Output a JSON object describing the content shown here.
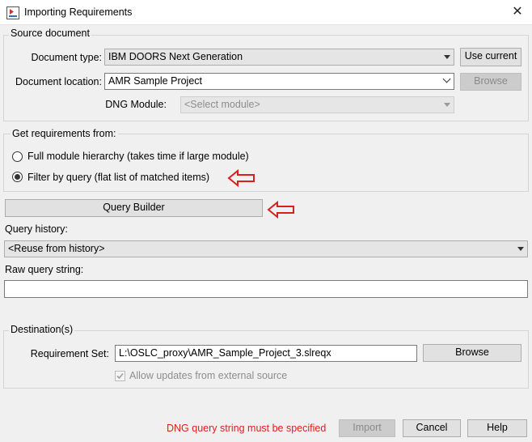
{
  "window": {
    "title": "Importing Requirements",
    "close_glyph": "✕"
  },
  "source": {
    "group_label": "Source document",
    "doc_type_label": "Document type:",
    "doc_type_value": "IBM DOORS Next Generation",
    "use_current_label": "Use current",
    "doc_location_label": "Document location:",
    "doc_location_value": "AMR Sample Project",
    "browse_label": "Browse",
    "module_label": "DNG Module:",
    "module_value": "<Select module>"
  },
  "get_reqs": {
    "group_label": "Get requirements from:",
    "option1": "Full module hierarchy (takes time if large module)",
    "option2": "Filter by query (flat list of matched items)",
    "selected": "option2"
  },
  "query": {
    "builder_label": "Query Builder",
    "history_label": "Query history:",
    "history_value": "<Reuse from history>",
    "raw_label": "Raw query string:",
    "raw_value": ""
  },
  "destination": {
    "group_label": "Destination(s)",
    "req_set_label": "Requirement Set:",
    "req_set_value": "L:\\OSLC_proxy\\AMR_Sample_Project_3.slreqx",
    "browse_label": "Browse",
    "allow_updates_label": "Allow updates from external source",
    "allow_updates_checked": true
  },
  "footer": {
    "error_text": "DNG query string must be specified",
    "import_label": "Import",
    "cancel_label": "Cancel",
    "help_label": "Help"
  },
  "colors": {
    "annotation_arrow": "#d9211c",
    "error": "#e0201b"
  }
}
